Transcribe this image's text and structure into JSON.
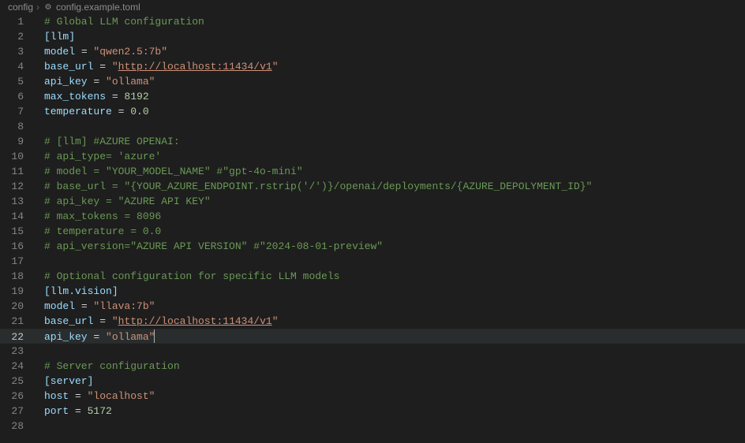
{
  "breadcrumb": {
    "folder": "config",
    "separator": "›",
    "file": "config.example.toml"
  },
  "activeLine": 22,
  "lines": [
    {
      "n": 1,
      "tokens": [
        {
          "t": "# Global LLM configuration",
          "c": "comment"
        }
      ]
    },
    {
      "n": 2,
      "tokens": [
        {
          "t": "[llm]",
          "c": "header"
        }
      ]
    },
    {
      "n": 3,
      "tokens": [
        {
          "t": "model",
          "c": "key"
        },
        {
          "t": " = ",
          "c": "op"
        },
        {
          "t": "\"qwen2.5:7b\"",
          "c": "string"
        }
      ]
    },
    {
      "n": 4,
      "tokens": [
        {
          "t": "base_url",
          "c": "key"
        },
        {
          "t": " = ",
          "c": "op"
        },
        {
          "t": "\"",
          "c": "string"
        },
        {
          "t": "http://localhost:11434/v1",
          "c": "url"
        },
        {
          "t": "\"",
          "c": "string"
        }
      ]
    },
    {
      "n": 5,
      "tokens": [
        {
          "t": "api_key",
          "c": "key"
        },
        {
          "t": " = ",
          "c": "op"
        },
        {
          "t": "\"ollama\"",
          "c": "string"
        }
      ]
    },
    {
      "n": 6,
      "tokens": [
        {
          "t": "max_tokens",
          "c": "key"
        },
        {
          "t": " = ",
          "c": "op"
        },
        {
          "t": "8192",
          "c": "number"
        }
      ]
    },
    {
      "n": 7,
      "tokens": [
        {
          "t": "temperature",
          "c": "key"
        },
        {
          "t": " = ",
          "c": "op"
        },
        {
          "t": "0.0",
          "c": "number"
        }
      ]
    },
    {
      "n": 8,
      "tokens": []
    },
    {
      "n": 9,
      "tokens": [
        {
          "t": "# [llm] #AZURE OPENAI:",
          "c": "comment"
        }
      ]
    },
    {
      "n": 10,
      "tokens": [
        {
          "t": "# api_type= 'azure'",
          "c": "comment"
        }
      ]
    },
    {
      "n": 11,
      "tokens": [
        {
          "t": "# model = \"YOUR_MODEL_NAME\" #\"gpt-4o-mini\"",
          "c": "comment"
        }
      ]
    },
    {
      "n": 12,
      "tokens": [
        {
          "t": "# base_url = \"{YOUR_AZURE_ENDPOINT.rstrip('/')}/openai/deployments/{AZURE_DEPOLYMENT_ID}\"",
          "c": "comment"
        }
      ]
    },
    {
      "n": 13,
      "tokens": [
        {
          "t": "# api_key = \"AZURE API KEY\"",
          "c": "comment"
        }
      ]
    },
    {
      "n": 14,
      "tokens": [
        {
          "t": "# max_tokens = 8096",
          "c": "comment"
        }
      ]
    },
    {
      "n": 15,
      "tokens": [
        {
          "t": "# temperature = 0.0",
          "c": "comment"
        }
      ]
    },
    {
      "n": 16,
      "tokens": [
        {
          "t": "# api_version=\"AZURE API VERSION\" #\"2024-08-01-preview\"",
          "c": "comment"
        }
      ]
    },
    {
      "n": 17,
      "tokens": []
    },
    {
      "n": 18,
      "tokens": [
        {
          "t": "# Optional configuration for specific LLM models",
          "c": "comment"
        }
      ]
    },
    {
      "n": 19,
      "tokens": [
        {
          "t": "[llm.vision]",
          "c": "header"
        }
      ]
    },
    {
      "n": 20,
      "tokens": [
        {
          "t": "model",
          "c": "key"
        },
        {
          "t": " = ",
          "c": "op"
        },
        {
          "t": "\"llava:7b\"",
          "c": "string"
        }
      ]
    },
    {
      "n": 21,
      "tokens": [
        {
          "t": "base_url",
          "c": "key"
        },
        {
          "t": " = ",
          "c": "op"
        },
        {
          "t": "\"",
          "c": "string"
        },
        {
          "t": "http://localhost:11434/v1",
          "c": "url"
        },
        {
          "t": "\"",
          "c": "string"
        }
      ]
    },
    {
      "n": 22,
      "tokens": [
        {
          "t": "api_key",
          "c": "key"
        },
        {
          "t": " = ",
          "c": "op"
        },
        {
          "t": "\"ollama\"",
          "c": "string"
        }
      ],
      "cursor": true
    },
    {
      "n": 23,
      "tokens": []
    },
    {
      "n": 24,
      "tokens": [
        {
          "t": "# Server configuration",
          "c": "comment"
        }
      ]
    },
    {
      "n": 25,
      "tokens": [
        {
          "t": "[server]",
          "c": "header"
        }
      ]
    },
    {
      "n": 26,
      "tokens": [
        {
          "t": "host",
          "c": "key"
        },
        {
          "t": " = ",
          "c": "op"
        },
        {
          "t": "\"localhost\"",
          "c": "string"
        }
      ]
    },
    {
      "n": 27,
      "tokens": [
        {
          "t": "port",
          "c": "key"
        },
        {
          "t": " = ",
          "c": "op"
        },
        {
          "t": "5172",
          "c": "number"
        }
      ]
    },
    {
      "n": 28,
      "tokens": []
    }
  ]
}
